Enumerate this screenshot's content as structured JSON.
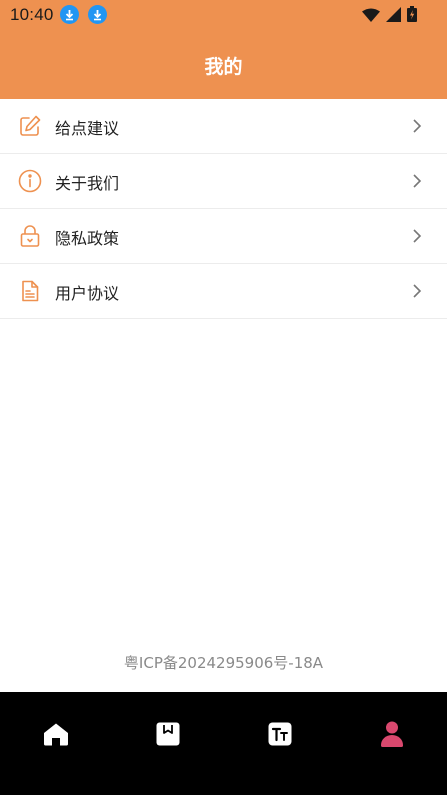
{
  "status_bar": {
    "time": "10:40",
    "notifications": [
      "download-icon",
      "download-icon"
    ],
    "indicators": [
      "wifi-icon",
      "signal-icon",
      "battery-charging-icon"
    ]
  },
  "header": {
    "title": "我的",
    "background": "#EE9150"
  },
  "menu": {
    "items": [
      {
        "label": "给点建议",
        "icon": "edit-icon"
      },
      {
        "label": "关于我们",
        "icon": "info-icon"
      },
      {
        "label": "隐私政策",
        "icon": "lock-icon"
      },
      {
        "label": "用户协议",
        "icon": "document-icon"
      }
    ],
    "icon_color": "#EE9150"
  },
  "footer": {
    "icp": "粤ICP备2024295906号-18A"
  },
  "tabbar": {
    "background": "#000000",
    "tabs": [
      {
        "icon": "home-icon",
        "active": false
      },
      {
        "icon": "bookmark-icon",
        "active": false
      },
      {
        "icon": "text-size-icon",
        "active": false
      },
      {
        "icon": "user-icon",
        "active": true
      }
    ],
    "active_color": "#D9486E"
  }
}
